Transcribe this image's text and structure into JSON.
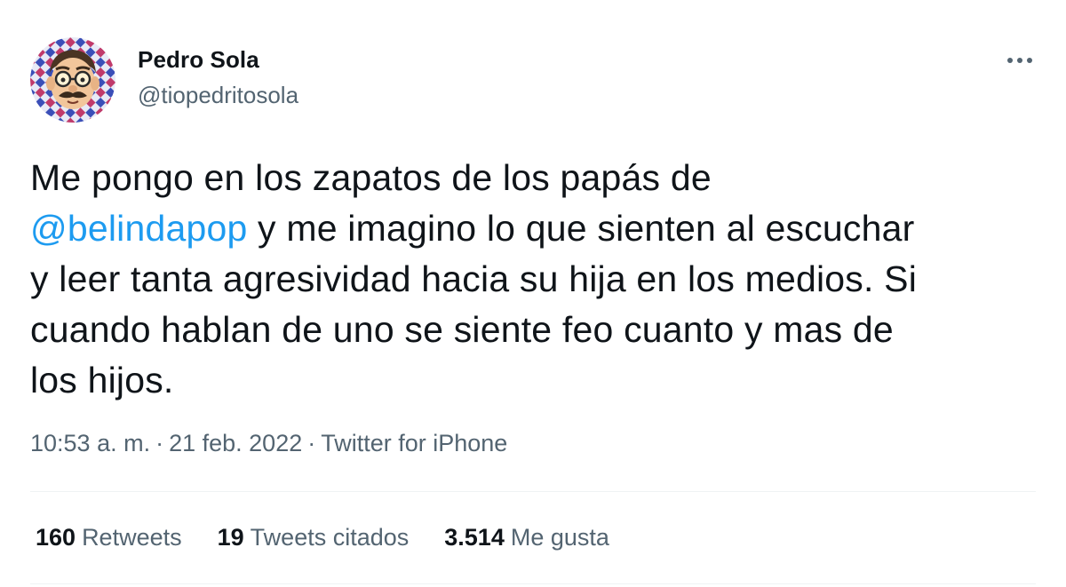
{
  "author": {
    "name": "Pedro Sola",
    "handle": "@tiopedritosola"
  },
  "tweet": {
    "lines": [
      {
        "pre": "Me pongo en los zapatos de los papás de"
      },
      {
        "mention": "@belindapop",
        "post": " y me imagino lo que sienten al escuchar"
      },
      {
        "pre": "y leer tanta agresividad hacia su hija en los medios. Si"
      },
      {
        "pre": "cuando hablan de uno se siente feo cuanto y mas de"
      },
      {
        "pre": "los hijos."
      }
    ]
  },
  "meta": {
    "time": "10:53 a. m.",
    "separator": "·",
    "date": "21 feb. 2022",
    "source": "Twitter for iPhone"
  },
  "stats": {
    "retweets": {
      "count": "160",
      "label": "Retweets"
    },
    "quotes": {
      "count": "19",
      "label": "Tweets citados"
    },
    "likes": {
      "count": "3.514",
      "label": "Me gusta"
    }
  },
  "icons": {
    "more": "more-options-icon",
    "avatar": "avatar-image"
  },
  "colors": {
    "text": "#0f1419",
    "secondary": "#536471",
    "link": "#1d9bf0",
    "divider": "#eff3f4"
  }
}
